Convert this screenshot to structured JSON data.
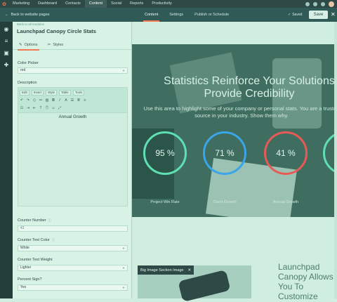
{
  "topnav": {
    "items": [
      "Marketing",
      "Dashboard",
      "Contacts",
      "Content",
      "Social",
      "Reports",
      "Productivity"
    ],
    "active_index": 3
  },
  "subbar": {
    "back_label": "Back to website pages",
    "tabs": [
      "Content",
      "Settings",
      "Publish or Schedule"
    ],
    "active_tab": 0,
    "saved_label": "Saved",
    "save_button": "Save"
  },
  "panel": {
    "breadcrumb": "Back to all modules",
    "module_title": "Launchpad Canopy Circle Stats",
    "tabs": [
      "Options",
      "Styles"
    ],
    "color_picker": {
      "label": "Color Picker",
      "value": "red"
    },
    "description": {
      "label": "Description",
      "toolbar_row1": [
        "Edit",
        "Insert",
        "Style",
        "Table",
        "Tools"
      ],
      "content": "Annual Growth"
    },
    "counter_number": {
      "label": "Counter Number",
      "value": "41"
    },
    "counter_text_color": {
      "label": "Counter Text Color",
      "value": "White"
    },
    "counter_text_weight": {
      "label": "Counter Text Weight",
      "value": "Lighter"
    },
    "percent_sign": {
      "label": "Percent Sign?",
      "value": "Yes"
    }
  },
  "preview": {
    "hero_title": "Statistics Reinforce Your Solutions Provide Credibility",
    "hero_sub": "Use this area to highlight some of your company or personal stats. You are a trusted source in your industry. Show them why.",
    "stats": [
      {
        "value": "95 %",
        "label": "Project Win Rate",
        "color": "#5fe0b4"
      },
      {
        "value": "71 %",
        "label": "Client Growth",
        "color": "#3aa5e8"
      },
      {
        "value": "41 %",
        "label": "Annual Growth",
        "color": "#e85a55"
      }
    ],
    "popup_label": "Big Image Section Image",
    "right_title": "Launchpad Canopy Allows You To Customize"
  },
  "colors": {
    "accent": "#f47a52",
    "nav_bg": "#2e4a47",
    "overlay": "#cfeee0"
  }
}
